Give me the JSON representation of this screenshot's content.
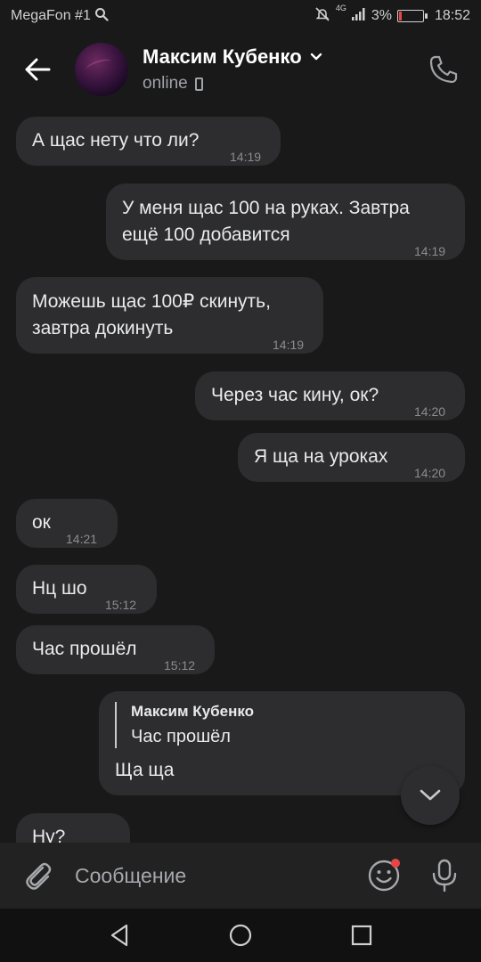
{
  "status_bar": {
    "carrier": "MegaFon #1",
    "network": "4G",
    "battery": "3%",
    "battery_level": 0.03,
    "time": "18:52"
  },
  "header": {
    "contact_name": "Максим Кубенко",
    "status": "online"
  },
  "messages": [
    {
      "direction": "in",
      "text": "А щас нету что ли?",
      "time": "14:19"
    },
    {
      "direction": "out",
      "text": "У меня щас 100 на руках. Завтра\nещё 100 добавится",
      "time": "14:19"
    },
    {
      "direction": "in",
      "text": "Можешь щас 100₽ скинуть,\nзавтра докинуть",
      "time": "14:19"
    },
    {
      "direction": "out",
      "text": "Через час кину, ок?",
      "time": "14:20"
    },
    {
      "direction": "out",
      "text": "Я ща на уроках",
      "time": "14:20"
    },
    {
      "direction": "in",
      "text": "ок",
      "time": "14:21"
    },
    {
      "direction": "in",
      "text": "Нц шо",
      "time": "15:12"
    },
    {
      "direction": "in",
      "text": "Час прошёл",
      "time": "15:12"
    },
    {
      "direction": "out",
      "reply": {
        "author": "Максим Кубенко",
        "text": "Час прошёл"
      },
      "text": "Ща ща"
    },
    {
      "direction": "in",
      "text": "Ну?"
    }
  ],
  "composer": {
    "placeholder": "Сообщение"
  },
  "icons": {
    "back": "arrow-left-icon",
    "chevron": "chevron-down-icon",
    "device": "mobile-phone-icon",
    "call": "phone-icon",
    "scroll_down": "chevron-down-icon",
    "attach": "paperclip-icon",
    "emoji": "smile-icon",
    "mic": "microphone-icon"
  },
  "colors": {
    "background": "#191919",
    "bubble": "#2d2d2f",
    "composer": "#222222",
    "notification_dot": "#e64646"
  }
}
